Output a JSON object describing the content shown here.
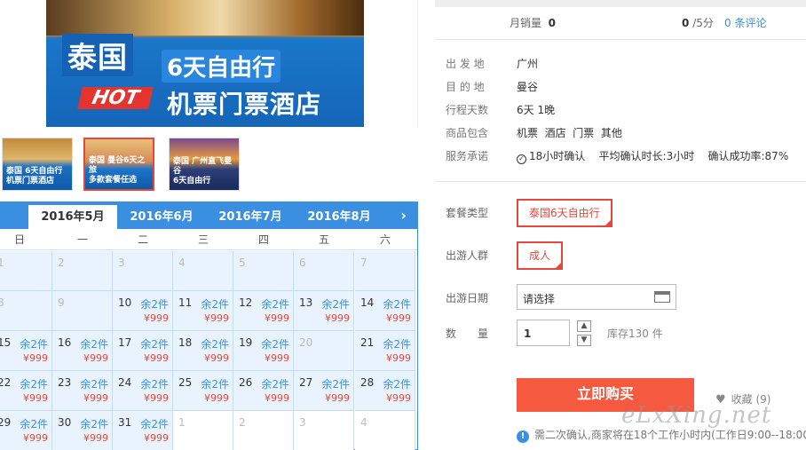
{
  "banner": {
    "title": "泰国",
    "subtitle": "6天自由行",
    "tagline": "机票门票酒店",
    "hot": "HOT"
  },
  "thumbnails": [
    {
      "line1": "泰国 6天自由行",
      "line2": "机票门票酒店"
    },
    {
      "line1": "泰国 曼谷6天之旅",
      "line2": "多款套餐任选"
    },
    {
      "line1": "泰国 广州直飞曼谷",
      "line2": "6天自由行"
    }
  ],
  "calendar": {
    "months": [
      "2016年5月",
      "2016年6月",
      "2016年7月",
      "2016年8月"
    ],
    "active_month": "2016年5月",
    "weekdays": [
      "日",
      "一",
      "二",
      "三",
      "四",
      "五",
      "六"
    ],
    "rows": [
      [
        {
          "d": "1",
          "a": false
        },
        {
          "d": "2",
          "a": false
        },
        {
          "d": "3",
          "a": false
        },
        {
          "d": "4",
          "a": false
        },
        {
          "d": "5",
          "a": false
        },
        {
          "d": "6",
          "a": false
        },
        {
          "d": "7",
          "a": false
        }
      ],
      [
        {
          "d": "8",
          "a": false
        },
        {
          "d": "9",
          "a": false
        },
        {
          "d": "10",
          "a": true
        },
        {
          "d": "11",
          "a": true
        },
        {
          "d": "12",
          "a": true
        },
        {
          "d": "13",
          "a": true
        },
        {
          "d": "14",
          "a": true
        }
      ],
      [
        {
          "d": "15",
          "a": true
        },
        {
          "d": "16",
          "a": true
        },
        {
          "d": "17",
          "a": true
        },
        {
          "d": "18",
          "a": true
        },
        {
          "d": "19",
          "a": true
        },
        {
          "d": "20",
          "a": false
        },
        {
          "d": "21",
          "a": true
        }
      ],
      [
        {
          "d": "22",
          "a": true
        },
        {
          "d": "23",
          "a": true
        },
        {
          "d": "24",
          "a": true
        },
        {
          "d": "25",
          "a": true
        },
        {
          "d": "26",
          "a": true
        },
        {
          "d": "27",
          "a": true
        },
        {
          "d": "28",
          "a": true
        }
      ],
      [
        {
          "d": "29",
          "a": true
        },
        {
          "d": "30",
          "a": true
        },
        {
          "d": "31",
          "a": true
        },
        {
          "d": "1",
          "a": false,
          "empty": true
        },
        {
          "d": "2",
          "a": false,
          "empty": true
        },
        {
          "d": "3",
          "a": false,
          "empty": true
        },
        {
          "d": "4",
          "a": false,
          "empty": true
        }
      ]
    ],
    "remaining_label": "余2件",
    "price_label": "¥999"
  },
  "stats": {
    "monthly_sales_label": "月销量",
    "monthly_sales_value": "0",
    "rating_value": "0",
    "rating_suffix": "/5分",
    "reviews_link": "0 条评论"
  },
  "info": [
    {
      "label": "出 发 地",
      "value": "广州"
    },
    {
      "label": "目 的 地",
      "value": "曼谷"
    },
    {
      "label": "行程天数",
      "value": "6天 1晚"
    },
    {
      "label": "商品包含",
      "value": "机票  酒店  门票  其他"
    }
  ],
  "service": {
    "label": "服务承诺",
    "confirm": "18小时确认",
    "avg": "平均确认时长:3小时",
    "success": "确认成功率:87%"
  },
  "options": {
    "package_label": "套餐类型",
    "package_value": "泰国6天自由行",
    "people_label": "出游人群",
    "people_value": "成人",
    "date_label": "出游日期",
    "date_placeholder": "请选择",
    "qty_label": "数　　量",
    "qty_value": "1",
    "stock": "库存130 件"
  },
  "actions": {
    "buy": "立即购买",
    "favorite": "收藏 (9)"
  },
  "notice": "需二次确认,商家将在18个工作小时内(工作日9:00--18:00)",
  "watermark": "eLxXing.net"
}
